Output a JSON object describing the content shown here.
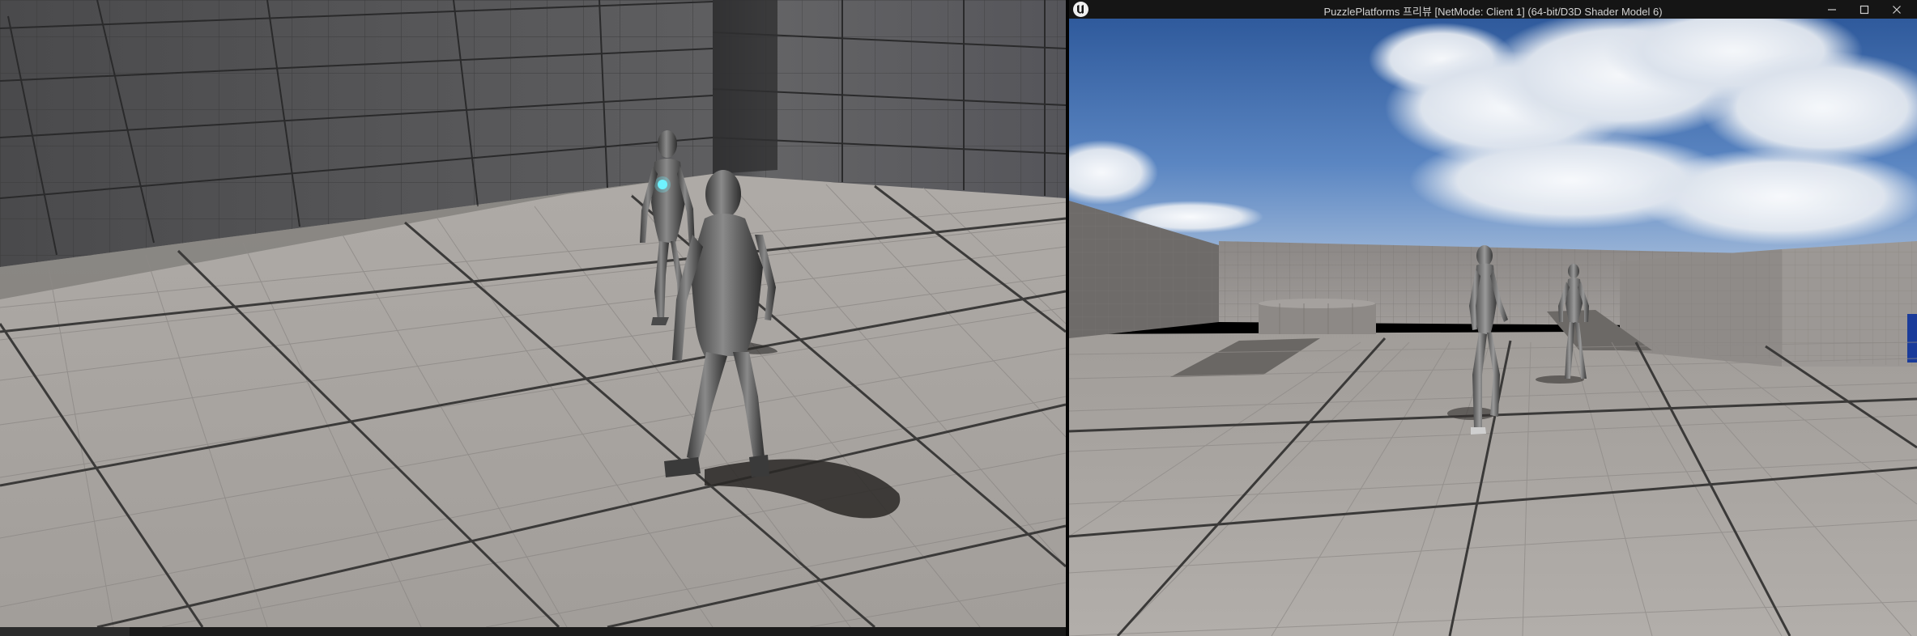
{
  "window": {
    "title": "PuzzlePlatforms 프리뷰 [NetMode: Client 1]  (64-bit/D3D Shader Model 6)",
    "logo_icon": "unreal-engine-logo-icon",
    "buttons": {
      "minimize_icon": "minimize-icon",
      "maximize_icon": "maximize-icon",
      "close_icon": "close-icon"
    }
  },
  "left_viewport": {
    "description_icon": "editor-viewport"
  },
  "colors": {
    "floor": "#a8a4a0",
    "wall": "#5a5a5c",
    "sky": "#3f6aa8",
    "titlebar": "#151515"
  }
}
